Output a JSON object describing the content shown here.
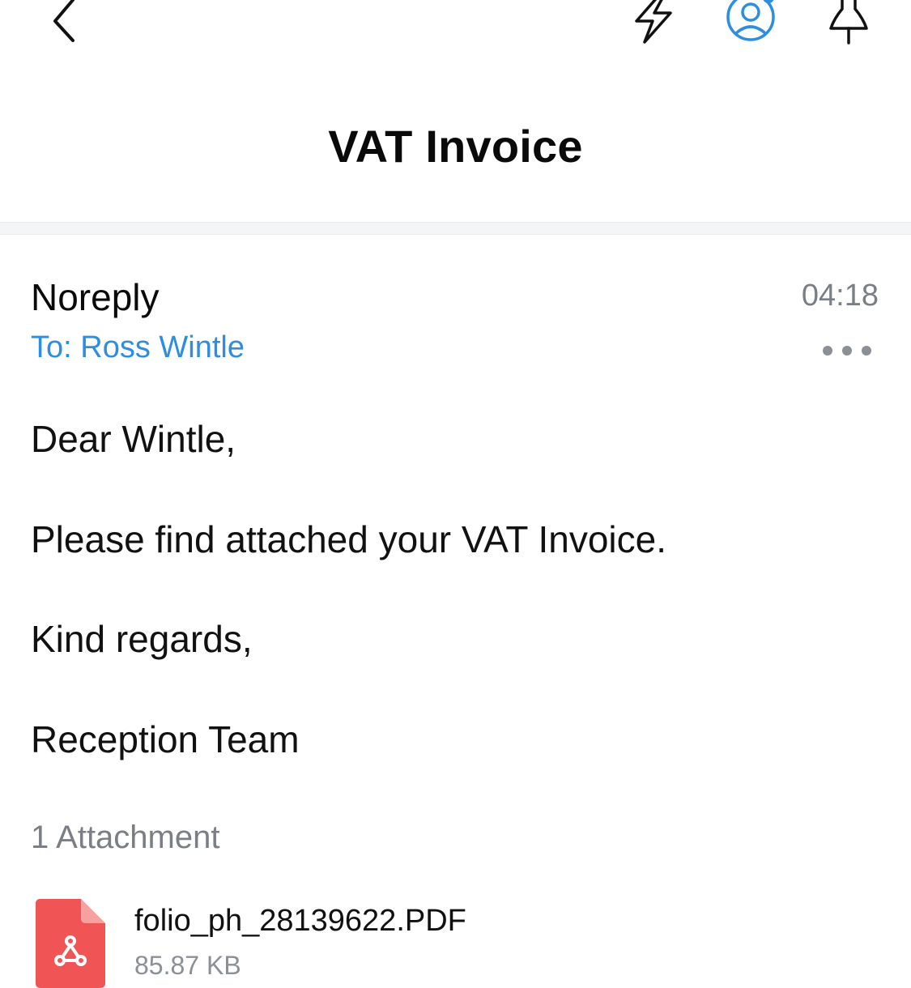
{
  "header": {
    "title": "VAT Invoice",
    "icons": [
      "back-chevron-icon",
      "lightning-icon",
      "account-icon",
      "pin-icon"
    ],
    "accent_color": "#2d8de0"
  },
  "message": {
    "sender": "Noreply",
    "time": "04:18",
    "recipient": "To: Ross Wintle",
    "body": [
      "Dear  Wintle,",
      "Please find attached your VAT Invoice.",
      "Kind regards,",
      "Reception Team"
    ]
  },
  "attachments": {
    "count_label": "1 Attachment",
    "items": [
      {
        "name": "folio_ph_28139622.PDF",
        "size": "85.87 KB",
        "icon": "pdf-file-icon",
        "color": "#f05454"
      }
    ]
  }
}
